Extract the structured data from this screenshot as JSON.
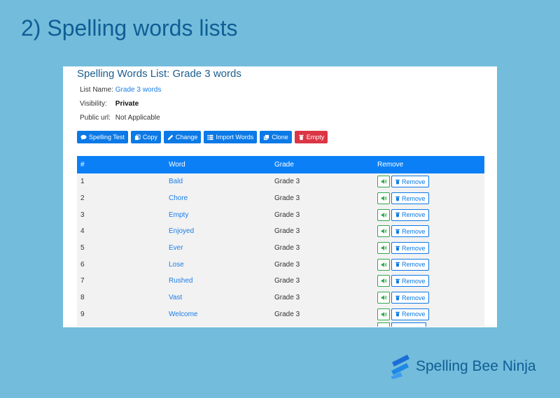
{
  "slide": {
    "title": "2) Spelling words lists"
  },
  "list": {
    "heading": "Spelling Words List: Grade 3 words",
    "name_label": "List Name:",
    "name_value": "Grade 3 words",
    "visibility_label": "Visibility:",
    "visibility_value": "Private",
    "public_url_label": "Public url:",
    "public_url_value": "Not Applicable"
  },
  "toolbar": {
    "spelling_test": "Spelling Test",
    "copy": "Copy",
    "change": "Change",
    "import_words": "Import Words",
    "clone": "Clone",
    "empty": "Empty"
  },
  "table": {
    "headers": {
      "num": "#",
      "word": "Word",
      "grade": "Grade",
      "remove": "Remove"
    },
    "remove_label": "Remove",
    "rows": [
      {
        "num": "1",
        "word": "Bald",
        "grade": "Grade 3"
      },
      {
        "num": "2",
        "word": "Chore",
        "grade": "Grade 3"
      },
      {
        "num": "3",
        "word": "Empty",
        "grade": "Grade 3"
      },
      {
        "num": "4",
        "word": "Enjoyed",
        "grade": "Grade 3"
      },
      {
        "num": "5",
        "word": "Ever",
        "grade": "Grade 3"
      },
      {
        "num": "6",
        "word": "Lose",
        "grade": "Grade 3"
      },
      {
        "num": "7",
        "word": "Rushed",
        "grade": "Grade 3"
      },
      {
        "num": "8",
        "word": "Vast",
        "grade": "Grade 3"
      },
      {
        "num": "9",
        "word": "Welcome",
        "grade": "Grade 3"
      }
    ]
  },
  "brand": {
    "name": "Spelling Bee Ninja"
  },
  "colors": {
    "accent": "#0b80f6",
    "danger": "#dc3545",
    "sound": "#31a84a",
    "background": "#73bcdc"
  },
  "icons": {
    "spelling_test": "chat-bubble-icon",
    "copy": "copy-icon",
    "change": "pencil-icon",
    "import_words": "list-icon",
    "clone": "clone-icon",
    "empty": "trash-icon",
    "sound": "speaker-icon",
    "remove": "trash-icon"
  }
}
